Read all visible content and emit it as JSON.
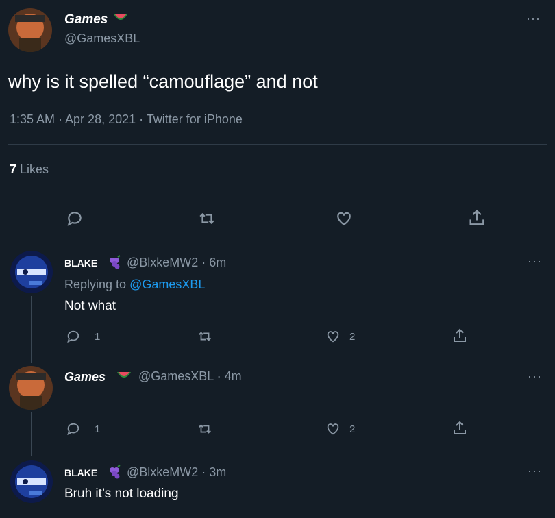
{
  "tweet": {
    "display_name": "Games",
    "handle": "@GamesXBL",
    "text": "why is it spelled “camouflage” and not",
    "meta": "1:35 AM · Apr 28, 2021 · Twitter for iPhone",
    "likes_count": "7",
    "likes_label": "Likes",
    "more": "···"
  },
  "replies": [
    {
      "display_name": "BLAKE",
      "handle_time": "@BlxkeMW2 · 6m",
      "replying_prefix": "Replying to",
      "replying_handle": "@GamesXBL",
      "text": "Not what",
      "reply_count": "1",
      "like_count": "2",
      "more": "···"
    },
    {
      "display_name": "Games",
      "handle_time": "@GamesXBL · 4m",
      "reply_count": "1",
      "like_count": "2",
      "more": "···"
    },
    {
      "display_name": "BLAKE",
      "handle_time": "@BlxkeMW2 · 3m",
      "text": "Bruh it’s not loading",
      "more": "···"
    }
  ],
  "colors": {
    "background": "#141d26",
    "text": "#ffffff",
    "muted": "#8b98a5",
    "link": "#1d9bf0",
    "divider": "#2f3b47"
  },
  "icons": {
    "reply": "reply-icon",
    "retweet": "retweet-icon",
    "like": "heart-icon",
    "share": "share-icon",
    "watermelon": "watermelon-emoji-icon",
    "grapes": "grapes-emoji-icon"
  }
}
